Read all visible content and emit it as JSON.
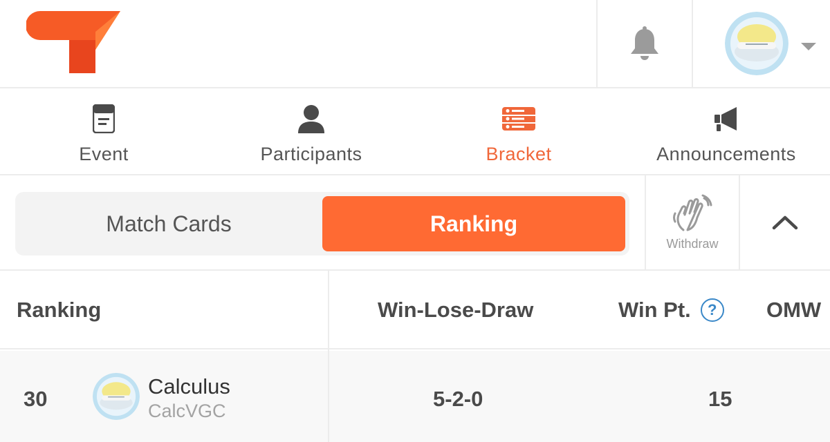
{
  "header": {
    "logo_icon": "brand-logo-icon",
    "notification_icon": "bell-icon",
    "account_menu_icon": "chevron-down-icon"
  },
  "nav": {
    "tabs": [
      {
        "label": "Event",
        "icon": "event-card-icon",
        "active": false
      },
      {
        "label": "Participants",
        "icon": "person-icon",
        "active": false
      },
      {
        "label": "Bracket",
        "icon": "bracket-list-icon",
        "active": true
      },
      {
        "label": "Announcements",
        "icon": "megaphone-icon",
        "active": false
      }
    ]
  },
  "view_toggle": {
    "match_cards_label": "Match Cards",
    "ranking_label": "Ranking",
    "selected": "Ranking"
  },
  "withdraw": {
    "label": "Withdraw",
    "icon": "waving-hand-icon"
  },
  "collapse_icon": "chevron-up-icon",
  "table": {
    "headers": {
      "ranking": "Ranking",
      "win_lose_draw": "Win-Lose-Draw",
      "win_pt": "Win Pt.",
      "win_pt_help": "?",
      "omw": "OMW"
    },
    "rows": [
      {
        "rank": "30",
        "name": "Calculus",
        "username": "CalcVGC",
        "win_lose_draw": "5-2-0",
        "win_pt": "15"
      }
    ]
  },
  "colors": {
    "accent": "#ff6a33",
    "active_tab": "#f0673a",
    "help_blue": "#3a88c8",
    "divider": "#ececec"
  }
}
